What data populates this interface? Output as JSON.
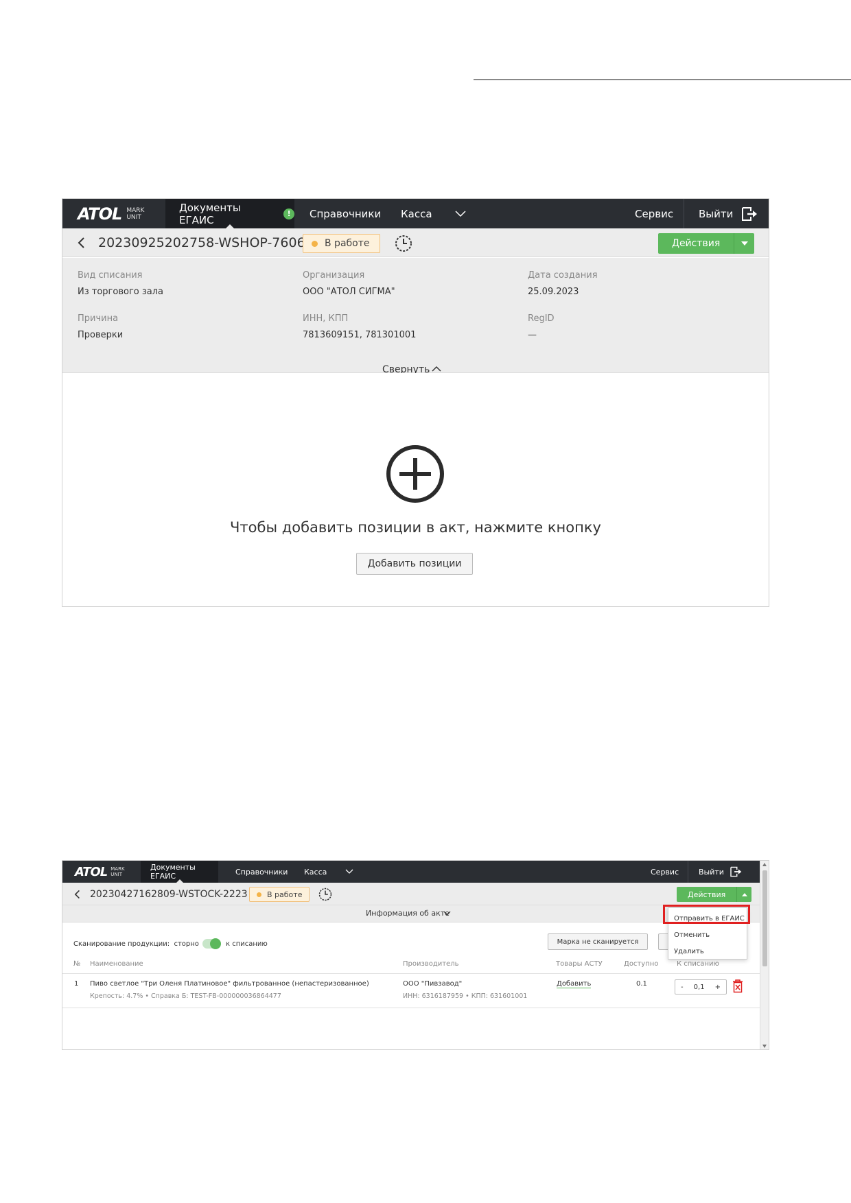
{
  "screenshot1": {
    "nav": {
      "logo": "ATOL",
      "logo_sub_1": "MARK",
      "logo_sub_2": "UNIT",
      "documents": "Документы ЕГАИС",
      "alert": "!",
      "references": "Справочники",
      "kassa": "Касса",
      "service": "Сервис",
      "exit": "Выйти"
    },
    "header": {
      "doc_id": "20230925202758-WSHOP-7606",
      "status": "В работе",
      "actions": "Действия"
    },
    "info": {
      "writeoff_type_label": "Вид списания",
      "writeoff_type_value": "Из торгового зала",
      "org_label": "Организация",
      "org_value": "ООО \"АТОЛ СИГМА\"",
      "created_label": "Дата создания",
      "created_value": "25.09.2023",
      "reason_label": "Причина",
      "reason_value": "Проверки",
      "inn_label": "ИНН, КПП",
      "inn_value": "7813609151, 781301001",
      "regid_label": "RegID",
      "regid_value": "—",
      "collapse": "Свернуть"
    },
    "empty": {
      "message": "Чтобы добавить позиции в акт, нажмите кнопку",
      "add_button": "Добавить позиции"
    }
  },
  "screenshot2": {
    "nav": {
      "logo": "ATOL",
      "logo_sub_1": "MARK",
      "logo_sub_2": "UNIT",
      "documents": "Документы ЕГАИС",
      "references": "Справочники",
      "kassa": "Касса",
      "service": "Сервис",
      "exit": "Выйти"
    },
    "header": {
      "doc_id": "20230427162809-WSTOCK-2223",
      "status": "В работе",
      "actions": "Действия"
    },
    "info_link": "Информация об акте",
    "scan": {
      "label": "Сканирование продукции:",
      "storno": "сторно",
      "writeoff": "к списанию",
      "not_scanned_button": "Марка не сканируется"
    },
    "table": {
      "headers": [
        "№",
        "Наименование",
        "Производитель",
        "Товары АСТУ",
        "Доступно",
        "К списанию"
      ],
      "rows": [
        {
          "num": "1",
          "name": "Пиво светлое \"Три Оленя Платиновое\" фильтрованное (непастеризованное)",
          "details": "Крепость: 4.7%   •   Справка Б: TEST-FB-000000036864477",
          "producer": "ООО \"Пивзавод\"",
          "producer_details": "ИНН: 6316187959   •   КПП: 631601001",
          "astu": "Добавить",
          "available": "0.1",
          "writeoff_qty": "0,1",
          "minus": "-",
          "plus": "+"
        }
      ]
    },
    "dropdown": {
      "send": "Отправить в ЕГАИС",
      "cancel": "Отменить",
      "delete": "Удалить"
    }
  }
}
